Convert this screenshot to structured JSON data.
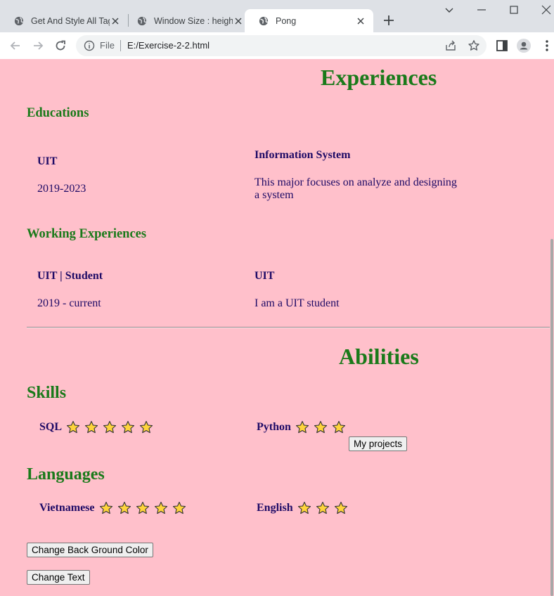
{
  "browser": {
    "tabs": [
      {
        "title": "Get And Style All Tag",
        "active": false
      },
      {
        "title": "Window Size : height",
        "active": false
      },
      {
        "title": "Pong",
        "active": true
      }
    ],
    "address": {
      "scheme_label": "File",
      "url": "E:/Exercise-2-2.html"
    }
  },
  "page": {
    "background": "#ffc0cb",
    "heading_color": "#1a7a1a",
    "text_color": "#1e0a66",
    "experiences": {
      "title": "Experiences",
      "educations": {
        "title": "Educations",
        "left": {
          "label": "UIT",
          "detail": "2019-2023"
        },
        "right": {
          "label": "Information System",
          "detail_line1": "This major focuses on analyze and designing",
          "detail_line2": "a system"
        }
      },
      "working": {
        "title": "Working Experiences",
        "left": {
          "label": "UIT | Student",
          "detail": "2019 - current"
        },
        "right": {
          "label": "UIT",
          "detail": "I am a UIT student"
        }
      }
    },
    "abilities": {
      "title": "Abilities",
      "skills": {
        "title": "Skills",
        "items": [
          {
            "name": "SQL",
            "stars": 5
          },
          {
            "name": "Python",
            "stars": 3
          }
        ]
      },
      "projects_button": "My projects",
      "languages": {
        "title": "Languages",
        "items": [
          {
            "name": "Vietnamese",
            "stars": 5
          },
          {
            "name": "English",
            "stars": 3
          }
        ]
      }
    },
    "buttons": {
      "change_bg": "Change Back Ground Color",
      "change_text": "Change Text"
    }
  }
}
